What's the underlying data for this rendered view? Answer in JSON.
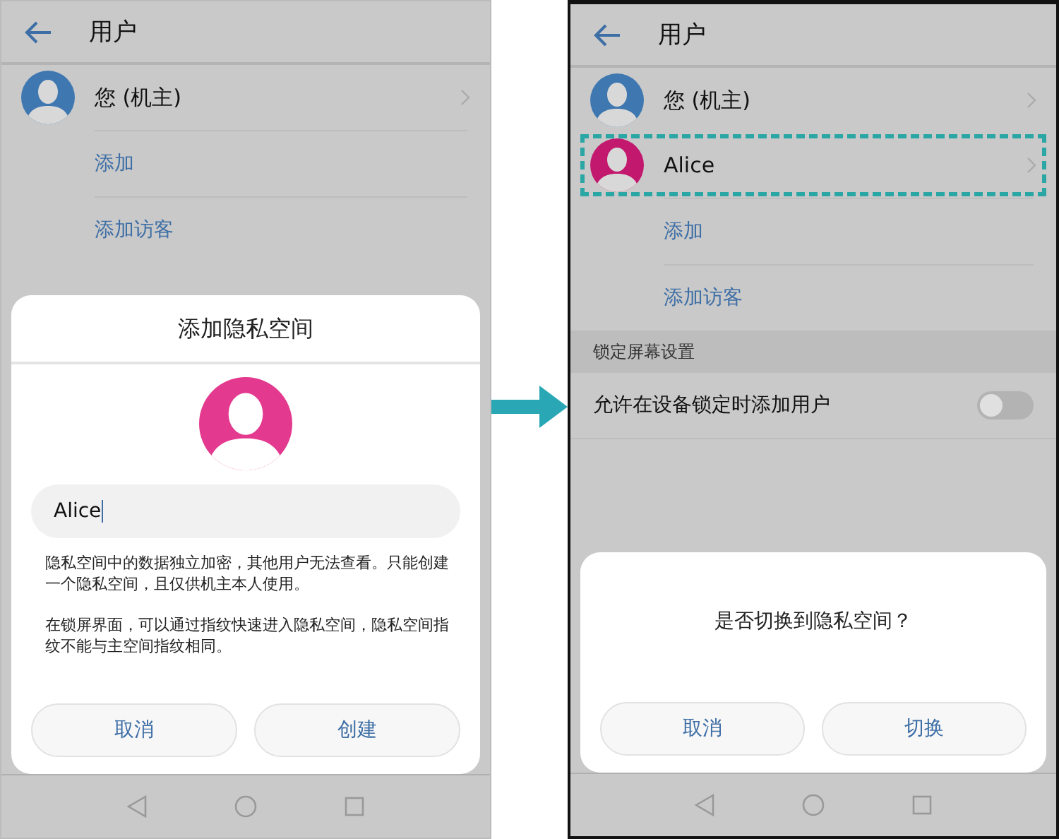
{
  "panels": [
    {
      "title": "用户",
      "users": [
        {
          "name": "您 (机主)",
          "color": "#3f78b0",
          "highlighted": false
        }
      ],
      "actions": [
        "添加",
        "添加访客"
      ],
      "dialog": {
        "kind": "form",
        "title": "添加隐私空间",
        "color": "#e3398f",
        "name_value": "Alice",
        "paragraphs": [
          "隐私空间中的数据独立加密，其他用户无法查看。只能创建一个隐私空间，且仅供机主本人使用。",
          "在锁屏界面，可以通过指纹快速进入隐私空间，隐私空间指纹不能与主空间指纹相同。"
        ],
        "buttons": [
          "取消",
          "创建"
        ]
      }
    },
    {
      "title": "用户",
      "users": [
        {
          "name": "您 (机主)",
          "color": "#3f78b0",
          "highlighted": false
        },
        {
          "name": "Alice",
          "color": "#c2186e",
          "highlighted": true
        }
      ],
      "actions": [
        "添加",
        "添加访客"
      ],
      "section": "锁定屏幕设置",
      "toggle": {
        "label": "允许在设备锁定时添加用户",
        "on": false
      },
      "dialog": {
        "kind": "confirm",
        "message": "是否切换到隐私空间？",
        "buttons": [
          "取消",
          "切换"
        ]
      }
    }
  ]
}
